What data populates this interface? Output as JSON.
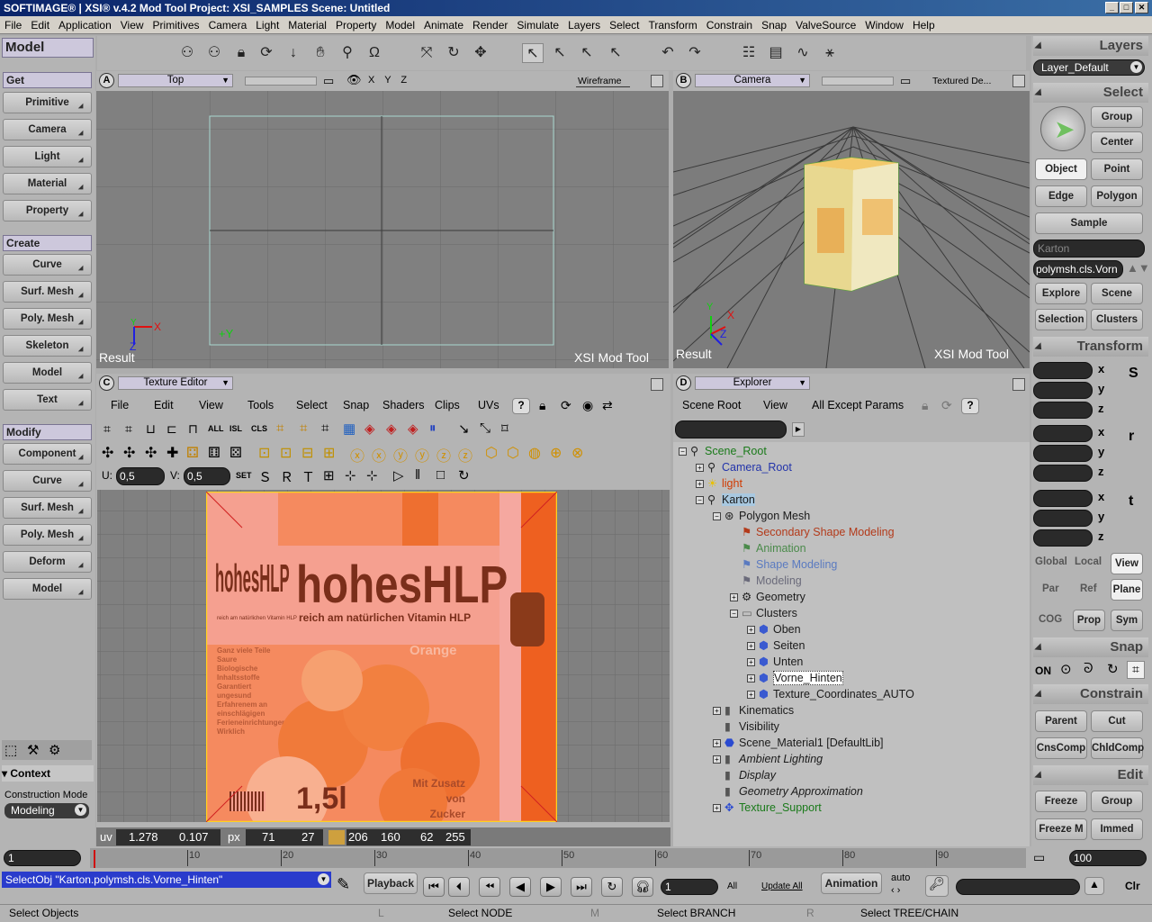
{
  "window": {
    "title": "SOFTIMAGE® | XSI® v.4.2 Mod Tool Project: XSI_SAMPLES    Scene: Untitled"
  },
  "menu": [
    "File",
    "Edit",
    "Application",
    "View",
    "Primitives",
    "Camera",
    "Light",
    "Material",
    "Property",
    "Model",
    "Animate",
    "Render",
    "Simulate",
    "Layers",
    "Select",
    "Transform",
    "Constrain",
    "Snap",
    "ValveSource",
    "Window",
    "Help"
  ],
  "left": {
    "header": "Model",
    "get_title": "Get",
    "get_items": [
      "Primitive",
      "Camera",
      "Light",
      "Material",
      "Property"
    ],
    "create_title": "Create",
    "create_items": [
      "Curve",
      "Surf. Mesh",
      "Poly. Mesh",
      "Skeleton",
      "Model",
      "Text"
    ],
    "modify_title": "Modify",
    "modify_items": [
      "Component",
      "Curve",
      "Surf. Mesh",
      "Poly. Mesh",
      "Deform",
      "Model"
    ],
    "context_label": "Context",
    "construction_label": "Construction Mode",
    "construction_value": "Modeling"
  },
  "viewA": {
    "letter": "A",
    "name": "Top",
    "mode": "Wireframe",
    "axes": "X Y Z",
    "footer_left": "Result",
    "footer_right": "XSI  Mod  Tool",
    "axis_x": "X",
    "axis_y": "Y",
    "axis_z": "Z",
    "origin": "+Y"
  },
  "viewB": {
    "letter": "B",
    "name": "Camera",
    "mode": "Textured De...",
    "footer_left": "Result",
    "footer_right": "XSI  Mod  Tool",
    "axis_x": "X",
    "axis_y": "Y",
    "axis_z": "Z"
  },
  "texture": {
    "letter": "C",
    "name": "Texture Editor",
    "menus": [
      "File",
      "Edit",
      "View",
      "Tools",
      "Select",
      "Snap",
      "Shaders",
      "Clips",
      "UVs"
    ],
    "toolbar_labels": [
      "ALL",
      "ISL",
      "CLS"
    ],
    "u_label": "U:",
    "u_value": "0,5",
    "v_label": "V:",
    "v_value": "0,5",
    "set_label": "SET",
    "pkg_brand": "hohesHLP",
    "pkg_brand2": "hohesHLP",
    "pkg_sub": "reich am natürlichen Vitamin HLP",
    "pkg_sub_small": "reich am natürlichen Vitamin HLP",
    "pkg_flavor": "Orange",
    "pkg_volume": "1,5l",
    "pkg_note": "Mit Zusatz\nvon\nZucker",
    "pkg_lines": [
      "Ganz viele Teile",
      "Saure",
      "Biologische",
      "Inhaltsstoffe",
      "Garantiert",
      "ungesund",
      "Erfahrenem an",
      "einschlägigen",
      "Ferieneinrichtungen",
      "Wirklich"
    ],
    "status_uv_label": "uv",
    "status_u": "1.278",
    "status_v": "0.107",
    "status_px_label": "px",
    "status_px_x": "71",
    "status_px_y": "27",
    "status_r": "206",
    "status_g": "160",
    "status_b": "62",
    "status_a": "255"
  },
  "explorer": {
    "letter": "D",
    "name": "Explorer",
    "btn_scene_root": "Scene Root",
    "btn_view": "View",
    "btn_filter": "All Except Params",
    "tree": [
      {
        "label": "Scene_Root",
        "color": "#1a7a1a",
        "pm": "-",
        "icon": "figure"
      },
      {
        "label": "Camera_Root",
        "color": "#2233aa",
        "pm": "+",
        "icon": "figure"
      },
      {
        "label": "light",
        "color": "#d03a00",
        "pm": "+",
        "icon": "light"
      },
      {
        "label": "Karton",
        "color": "#1a1a1a",
        "pm": "-",
        "icon": "figure",
        "hl": true
      },
      {
        "label": "Polygon Mesh",
        "color": "#1a1a1a",
        "pm": "-",
        "icon": "mesh"
      },
      {
        "label": "Secondary Shape Modeling",
        "color": "#b33a1a",
        "pm": "",
        "icon": "flag"
      },
      {
        "label": "Animation",
        "color": "#4a8a4a",
        "pm": "",
        "icon": "flag"
      },
      {
        "label": "Shape Modeling",
        "color": "#5a7ac0",
        "pm": "",
        "icon": "flag"
      },
      {
        "label": "Modeling",
        "color": "#6a6a7a",
        "pm": "",
        "icon": "flag"
      },
      {
        "label": "Geometry",
        "color": "#1a1a1a",
        "pm": "+",
        "icon": "gear"
      },
      {
        "label": "Clusters",
        "color": "#1a1a1a",
        "pm": "-",
        "icon": "folder"
      },
      {
        "label": "Oben",
        "color": "#1a1a1a",
        "pm": "+",
        "icon": "cluster"
      },
      {
        "label": "Seiten",
        "color": "#1a1a1a",
        "pm": "+",
        "icon": "cluster"
      },
      {
        "label": "Unten",
        "color": "#1a1a1a",
        "pm": "+",
        "icon": "cluster"
      },
      {
        "label": "Vorne_Hinten",
        "color": "#1a1a1a",
        "pm": "+",
        "icon": "cluster",
        "sel": true
      },
      {
        "label": "Texture_Coordinates_AUTO",
        "color": "#1a1a1a",
        "pm": "+",
        "icon": "cluster"
      },
      {
        "label": "Kinematics",
        "color": "#1a1a1a",
        "pm": "+",
        "icon": "bar"
      },
      {
        "label": "Visibility",
        "color": "#1a1a1a",
        "pm": "",
        "icon": "bar"
      },
      {
        "label": "Scene_Material1 [DefaultLib]",
        "color": "#1a1a1a",
        "pm": "+",
        "icon": "mat"
      },
      {
        "label": "Ambient Lighting",
        "color": "#1a1a1a",
        "pm": "+",
        "icon": "bar",
        "italic": true
      },
      {
        "label": "Display",
        "color": "#1a1a1a",
        "pm": "",
        "icon": "bar",
        "italic": true
      },
      {
        "label": "Geometry Approximation",
        "color": "#1a1a1a",
        "pm": "",
        "icon": "bar",
        "italic": true
      },
      {
        "label": "Texture_Support",
        "color": "#1a7a1a",
        "pm": "+",
        "icon": "support"
      }
    ]
  },
  "right": {
    "layers_title": "Layers",
    "layer_value": "Layer_Default",
    "select_title": "Select",
    "btn_group": "Group",
    "btn_center": "Center",
    "btn_object": "Object",
    "btn_point": "Point",
    "btn_edge": "Edge",
    "btn_polygon": "Polygon",
    "btn_sample": "Sample",
    "field_karton": "Karton",
    "field_cluster": "polymsh.cls.Vorn",
    "btn_explore": "Explore",
    "btn_scene": "Scene",
    "btn_selection": "Selection",
    "btn_clusters": "Clusters",
    "transform_title": "Transform",
    "xyz": [
      "x",
      "y",
      "z"
    ],
    "opt_global": "Global",
    "opt_local": "Local",
    "opt_view": "View",
    "opt_par": "Par",
    "opt_ref": "Ref",
    "opt_plane": "Plane",
    "opt_cog": "COG",
    "opt_prop": "Prop",
    "opt_sym": "Sym",
    "snap_title": "Snap",
    "snap_on": "ON",
    "constrain_title": "Constrain",
    "btn_parent": "Parent",
    "btn_cut": "Cut",
    "btn_cnscomp": "CnsComp",
    "btn_chldcomp": "ChldComp",
    "edit_title": "Edit",
    "btn_freeze": "Freeze",
    "btn_group2": "Group",
    "btn_freezem": "Freeze M",
    "btn_immed": "Immed"
  },
  "timeline": {
    "start": "1",
    "end": "100",
    "ticks": [
      "10",
      "20",
      "30",
      "40",
      "50",
      "60",
      "70",
      "80",
      "90"
    ]
  },
  "playback": {
    "command": "SelectObj \"Karton.polymsh.cls.Vorne_Hinten\"",
    "playback_label": "Playback",
    "frame": "1",
    "all": "All",
    "update": "Update All",
    "animation": "Animation",
    "auto": "auto",
    "clr": "Clr"
  },
  "status": {
    "left": "Select Objects",
    "l_key": "L",
    "l_text": "Select NODE",
    "m_key": "M",
    "m_text": "Select BRANCH",
    "r_key": "R",
    "r_text": "Select TREE/CHAIN"
  }
}
